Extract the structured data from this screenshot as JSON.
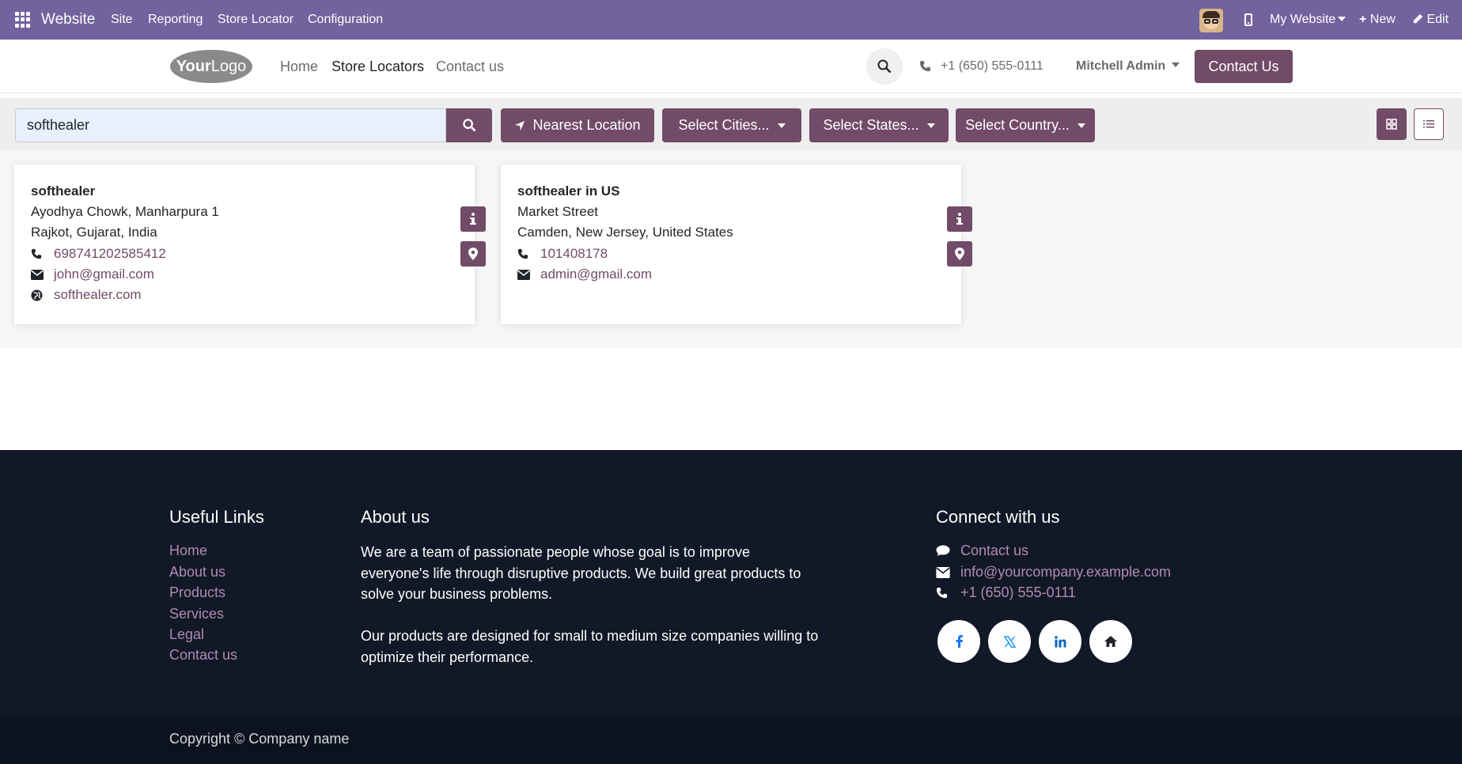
{
  "admin_bar": {
    "app_name": "Website",
    "menus": [
      "Site",
      "Reporting",
      "Store Locator",
      "Configuration"
    ],
    "website_switcher": "My Website",
    "new_label": "New",
    "edit_label": "Edit"
  },
  "header": {
    "logo_text": "YourLogo",
    "nav": [
      "Home",
      "Store Locators",
      "Contact us"
    ],
    "phone": "+1 (650) 555-0111",
    "user": "Mitchell Admin",
    "contact_button": "Contact Us"
  },
  "filters": {
    "search_value": "softhealer",
    "nearest_label": "Nearest Location",
    "cities_label": "Select Cities...",
    "states_label": "Select States...",
    "country_label": "Select Country..."
  },
  "stores": [
    {
      "name": "softhealer",
      "street": "Ayodhya Chowk, Manharpura 1",
      "city_line": "Rajkot, Gujarat, India",
      "phone": "698741202585412",
      "email": "john@gmail.com",
      "website": "softhealer.com"
    },
    {
      "name": "softhealer in US",
      "street": "Market Street",
      "city_line": "Camden, New Jersey, United States",
      "phone": "101408178",
      "email": "admin@gmail.com"
    }
  ],
  "footer": {
    "useful_links_title": "Useful Links",
    "useful_links": [
      "Home",
      "About us",
      "Products",
      "Services",
      "Legal",
      "Contact us"
    ],
    "about_title": "About us",
    "about_p1": "We are a team of passionate people whose goal is to improve everyone's life through disruptive products. We build great products to solve your business problems.",
    "about_p2": "Our products are designed for small to medium size companies willing to optimize their performance.",
    "connect_title": "Connect with us",
    "connect_contact": "Contact us",
    "connect_email": "info@yourcompany.example.com",
    "connect_phone": "+1 (650) 555-0111",
    "social_icons": [
      "facebook-icon",
      "x-twitter-icon",
      "linkedin-icon",
      "home-icon"
    ],
    "copyright": "Copyright © Company name"
  },
  "colors": {
    "admin_bar": "#71639e",
    "brand": "#714b67",
    "footer_bg": "#111827",
    "footer_link": "#b48aad"
  }
}
